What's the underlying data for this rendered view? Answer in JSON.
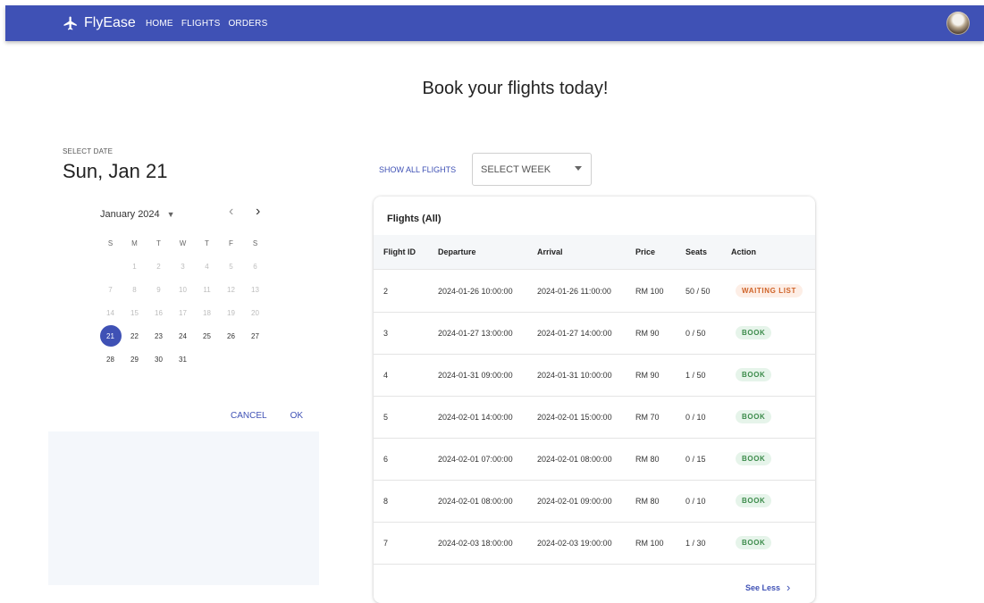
{
  "app": {
    "name": "FlyEase"
  },
  "nav": [
    "HOME",
    "FLIGHTS",
    "ORDERS"
  ],
  "headline": "Book your flights today!",
  "datepicker": {
    "label": "SELECT DATE",
    "selected_display": "Sun, Jan 21",
    "month_label": "January 2024",
    "weekdays": [
      "S",
      "M",
      "T",
      "W",
      "T",
      "F",
      "S"
    ],
    "leading_blanks": 1,
    "days": [
      "1",
      "2",
      "3",
      "4",
      "5",
      "6",
      "7",
      "8",
      "9",
      "10",
      "11",
      "12",
      "13",
      "14",
      "15",
      "16",
      "17",
      "18",
      "19",
      "20",
      "21",
      "22",
      "23",
      "24",
      "25",
      "26",
      "27",
      "28",
      "29",
      "30",
      "31"
    ],
    "disabled_through": 20,
    "selected_day": 21,
    "cancel_label": "CANCEL",
    "ok_label": "OK"
  },
  "filters": {
    "show_all_label": "SHOW ALL FLIGHTS",
    "week_select_label": "SELECT WEEK"
  },
  "table": {
    "title": "Flights (All)",
    "columns": [
      "Flight ID",
      "Departure",
      "Arrival",
      "Price",
      "Seats",
      "Action"
    ],
    "rows": [
      {
        "id": "2",
        "departure": "2024-01-26 10:00:00",
        "arrival": "2024-01-26 11:00:00",
        "price": "RM 100",
        "seats": "50 / 50",
        "action": "WAITING LIST",
        "action_type": "wait"
      },
      {
        "id": "3",
        "departure": "2024-01-27 13:00:00",
        "arrival": "2024-01-27 14:00:00",
        "price": "RM 90",
        "seats": "0 / 50",
        "action": "BOOK",
        "action_type": "book"
      },
      {
        "id": "4",
        "departure": "2024-01-31 09:00:00",
        "arrival": "2024-01-31 10:00:00",
        "price": "RM 90",
        "seats": "1 / 50",
        "action": "BOOK",
        "action_type": "book"
      },
      {
        "id": "5",
        "departure": "2024-02-01 14:00:00",
        "arrival": "2024-02-01 15:00:00",
        "price": "RM 70",
        "seats": "0 / 10",
        "action": "BOOK",
        "action_type": "book"
      },
      {
        "id": "6",
        "departure": "2024-02-01 07:00:00",
        "arrival": "2024-02-01 08:00:00",
        "price": "RM 80",
        "seats": "0 / 15",
        "action": "BOOK",
        "action_type": "book"
      },
      {
        "id": "8",
        "departure": "2024-02-01 08:00:00",
        "arrival": "2024-02-01 09:00:00",
        "price": "RM 80",
        "seats": "0 / 10",
        "action": "BOOK",
        "action_type": "book"
      },
      {
        "id": "7",
        "departure": "2024-02-03 18:00:00",
        "arrival": "2024-02-03 19:00:00",
        "price": "RM 100",
        "seats": "1 / 30",
        "action": "BOOK",
        "action_type": "book"
      }
    ],
    "see_less_label": "See Less"
  },
  "icons": {
    "brand": "airplane-icon",
    "dropdown": "chevron-down-icon",
    "prev": "chevron-left-icon",
    "next": "chevron-right-icon"
  },
  "colors": {
    "primary": "#3f51b5",
    "book_bg": "#e6f4ea",
    "book_text": "#3c8b4b",
    "wait_bg": "#fdeee6",
    "wait_text": "#cf6328"
  }
}
